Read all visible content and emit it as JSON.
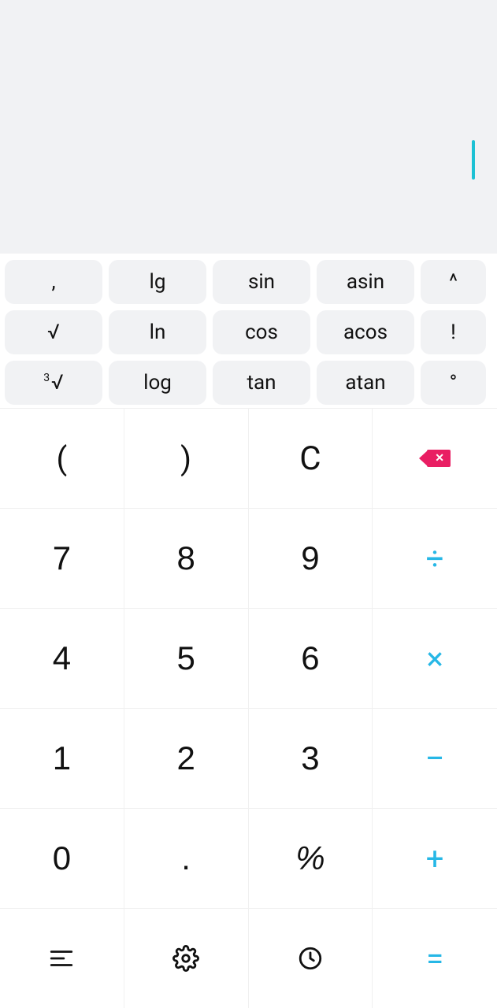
{
  "display": {
    "value": ""
  },
  "sci_rows": [
    [
      {
        "label": ",",
        "name": "comma"
      },
      {
        "label": "lg",
        "name": "lg"
      },
      {
        "label": "sin",
        "name": "sin"
      },
      {
        "label": "asin",
        "name": "asin"
      },
      {
        "label": "^",
        "name": "power"
      }
    ],
    [
      {
        "label": "√",
        "name": "sqrt"
      },
      {
        "label": "ln",
        "name": "ln"
      },
      {
        "label": "cos",
        "name": "cos"
      },
      {
        "label": "acos",
        "name": "acos"
      },
      {
        "label": "!",
        "name": "factorial"
      }
    ],
    [
      {
        "label": "³√",
        "name": "cbrt",
        "sup": "3",
        "base": "√"
      },
      {
        "label": "log",
        "name": "log"
      },
      {
        "label": "tan",
        "name": "tan"
      },
      {
        "label": "atan",
        "name": "atan"
      },
      {
        "label": "°",
        "name": "degree"
      }
    ]
  ],
  "pad": {
    "row1": {
      "lparen": "(",
      "rparen": ")",
      "clear": "C",
      "backspace": "backspace-icon"
    },
    "row2": {
      "n7": "7",
      "n8": "8",
      "n9": "9",
      "divide": "÷"
    },
    "row3": {
      "n4": "4",
      "n5": "5",
      "n6": "6",
      "multiply": "×"
    },
    "row4": {
      "n1": "1",
      "n2": "2",
      "n3": "3",
      "minus": "−"
    },
    "row5": {
      "n0": "0",
      "dot": ".",
      "percent": "%",
      "plus": "+"
    },
    "row6": {
      "menu": "menu-icon",
      "settings": "gear-icon",
      "history": "clock-icon",
      "equals": "="
    }
  },
  "colors": {
    "accent": "#26b7e6",
    "backspace": "#e91e63"
  }
}
